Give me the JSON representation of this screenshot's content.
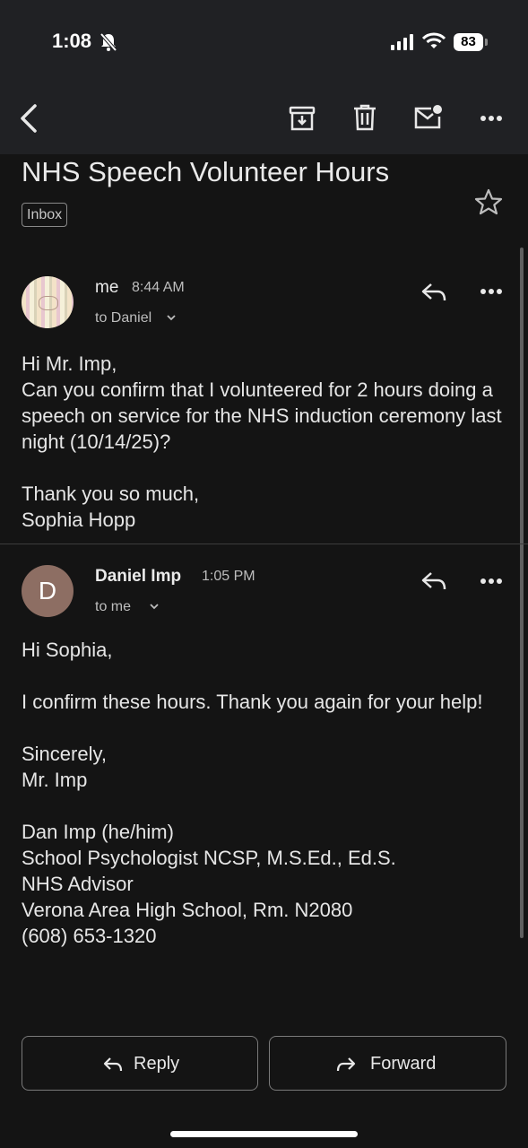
{
  "status_bar": {
    "time": "1:08",
    "battery": "83"
  },
  "email": {
    "subject": "NHS Speech Volunteer Hours",
    "label": "Inbox"
  },
  "messages": [
    {
      "sender": "me",
      "time": "8:44 AM",
      "to": "to Daniel",
      "body": "Hi Mr. Imp,\nCan you confirm that I volunteered for 2 hours doing a speech on service for the NHS induction ceremony last night (10/14/25)?\n\nThank you so much,\nSophia Hopp"
    },
    {
      "sender": "Daniel Imp",
      "avatar_letter": "D",
      "time": "1:05 PM",
      "to": "to me",
      "body": "Hi Sophia,\n\nI confirm these hours. Thank you again for your help!\n\nSincerely,\nMr. Imp\n\nDan Imp (he/him)\nSchool Psychologist NCSP, M.S.Ed., Ed.S.\nNHS Advisor\nVerona Area High School, Rm. N2080\n(608) 653-1320"
    }
  ],
  "actions": {
    "reply": "Reply",
    "forward": "Forward"
  },
  "colors": {
    "background": "#141414",
    "toolbar": "#202124",
    "avatar_d": "#8d6e63"
  }
}
